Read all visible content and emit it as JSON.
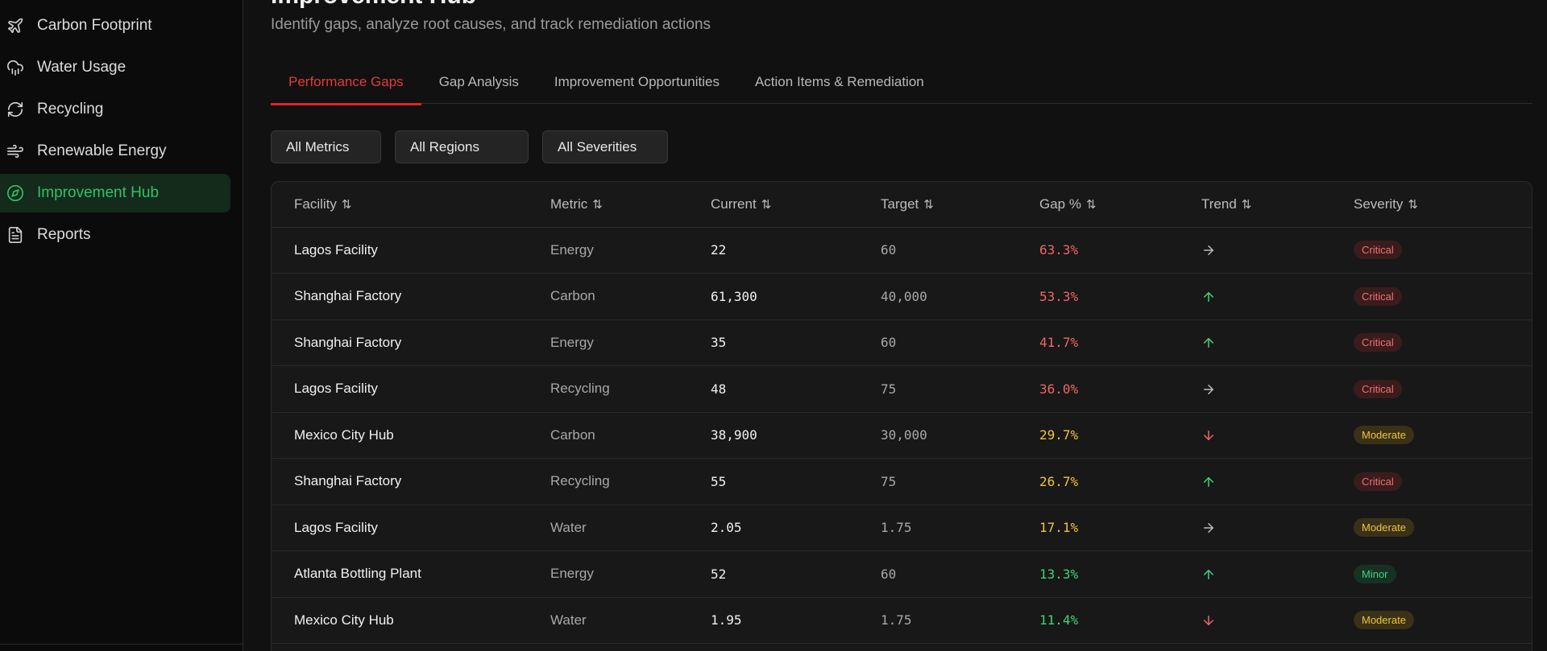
{
  "sidebar": {
    "items": [
      {
        "label": "Carbon Footprint",
        "icon": "plane-icon",
        "active": false
      },
      {
        "label": "Water Usage",
        "icon": "cloud-rain-icon",
        "active": false
      },
      {
        "label": "Recycling",
        "icon": "refresh-icon",
        "active": false
      },
      {
        "label": "Renewable Energy",
        "icon": "wind-icon",
        "active": false
      },
      {
        "label": "Improvement Hub",
        "icon": "compass-icon",
        "active": true
      },
      {
        "label": "Reports",
        "icon": "document-icon",
        "active": false
      }
    ]
  },
  "header": {
    "title": "Improvement Hub",
    "subtitle": "Identify gaps, analyze root causes, and track remediation actions"
  },
  "tabs": [
    {
      "label": "Performance Gaps",
      "active": true
    },
    {
      "label": "Gap Analysis",
      "active": false
    },
    {
      "label": "Improvement Opportunities",
      "active": false
    },
    {
      "label": "Action Items & Remediation",
      "active": false
    }
  ],
  "filters": {
    "metric": "All Metrics",
    "region": "All Regions",
    "severity": "All Severities"
  },
  "table": {
    "columns": [
      "Facility",
      "Metric",
      "Current",
      "Target",
      "Gap %",
      "Trend",
      "Severity"
    ],
    "rows": [
      {
        "facility": "Lagos Facility",
        "metric": "Energy",
        "current": "22",
        "target": "60",
        "gap": "63.3%",
        "trend": "flat",
        "severity": "Critical"
      },
      {
        "facility": "Shanghai Factory",
        "metric": "Carbon",
        "current": "61,300",
        "target": "40,000",
        "gap": "53.3%",
        "trend": "up",
        "severity": "Critical"
      },
      {
        "facility": "Shanghai Factory",
        "metric": "Energy",
        "current": "35",
        "target": "60",
        "gap": "41.7%",
        "trend": "up",
        "severity": "Critical"
      },
      {
        "facility": "Lagos Facility",
        "metric": "Recycling",
        "current": "48",
        "target": "75",
        "gap": "36.0%",
        "trend": "flat",
        "severity": "Critical"
      },
      {
        "facility": "Mexico City Hub",
        "metric": "Carbon",
        "current": "38,900",
        "target": "30,000",
        "gap": "29.7%",
        "trend": "down",
        "severity": "Moderate"
      },
      {
        "facility": "Shanghai Factory",
        "metric": "Recycling",
        "current": "55",
        "target": "75",
        "gap": "26.7%",
        "trend": "up",
        "severity": "Critical"
      },
      {
        "facility": "Lagos Facility",
        "metric": "Water",
        "current": "2.05",
        "target": "1.75",
        "gap": "17.1%",
        "trend": "flat",
        "severity": "Moderate"
      },
      {
        "facility": "Atlanta Bottling Plant",
        "metric": "Energy",
        "current": "52",
        "target": "60",
        "gap": "13.3%",
        "trend": "up",
        "severity": "Minor"
      },
      {
        "facility": "Mexico City Hub",
        "metric": "Water",
        "current": "1.95",
        "target": "1.75",
        "gap": "11.4%",
        "trend": "down",
        "severity": "Moderate"
      }
    ]
  },
  "colors": {
    "accent_green": "#2fc266",
    "accent_red": "#e02424",
    "gap_high": "#f06565",
    "gap_mid": "#f0c33c",
    "gap_low": "#3ed47a",
    "trend_up": "#3ed47a",
    "trend_down": "#f06565",
    "trend_flat": "#bdbdbd"
  }
}
